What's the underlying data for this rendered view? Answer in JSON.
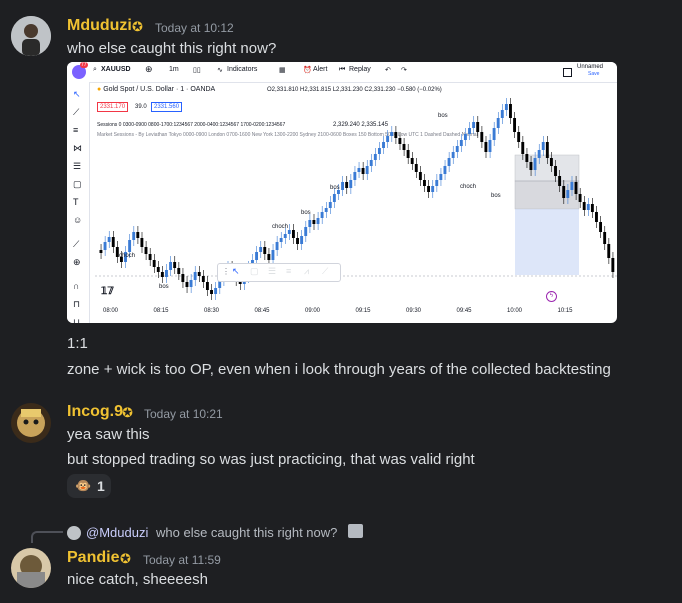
{
  "messages": [
    {
      "username": "Mduduzi",
      "timestamp": "Today at 10:12",
      "text": "who else caught this right now?",
      "after_image": [
        "1:1",
        "zone + wick is too OP, even when i look through years of the collected backtesting"
      ]
    },
    {
      "username": "Incog.9",
      "timestamp": "Today at 10:21",
      "lines": [
        "yea saw this",
        "but stopped trading so was just practicing, that was valid right"
      ],
      "reaction": {
        "icon": "monkey-emoji",
        "count": "1"
      }
    },
    {
      "username": "Pandie",
      "timestamp": "Today at 11:59",
      "text": "nice catch, sheeeesh",
      "reply": {
        "mention": "@Mduduzi",
        "text": "who else caught this right now?"
      }
    }
  ],
  "chart": {
    "symbol": "XAUUSD",
    "timeframe": "1m",
    "indicators_label": "Indicators",
    "alert_label": "Alert",
    "replay_label": "Replay",
    "unnamed_label": "Unnamed",
    "save_label": "Save",
    "title": "Gold Spot / U.S. Dollar · 1 · OANDA",
    "ohlc": "O2,331.810 H2,331.815 L2,331.230 C2,331.230 −0.580 (−0.02%)",
    "bid": "2331.170",
    "spread": "39.0",
    "ask": "2331.560",
    "sessions": "Sessions 0 0300-0900 0800-1700:1234567 2000-0400:1234567 1700-0200:1234567",
    "sessions_values": "2,329.240  2,335.145",
    "market_sessions": "Market Sessions - By Leviathan Tokyo 0000-0900 London 0700-1600 New York 1300-2200 Sydney 2100-0600 Boxes 150 Bottom 50 % Low UTC 1 Dashed Dashed Normal",
    "labels": {
      "bos": "bos",
      "choch": "choch"
    },
    "time_ticks": [
      "08:00",
      "08:15",
      "08:30",
      "08:45",
      "09:00",
      "09:15",
      "09:30",
      "09:45",
      "10:00",
      "10:15"
    ],
    "notification_badge": "77",
    "colors": {
      "up": "#3a7bd5",
      "down": "#000000",
      "zone": "#d1d4dc",
      "box_blue": "#c7d6f5"
    }
  }
}
